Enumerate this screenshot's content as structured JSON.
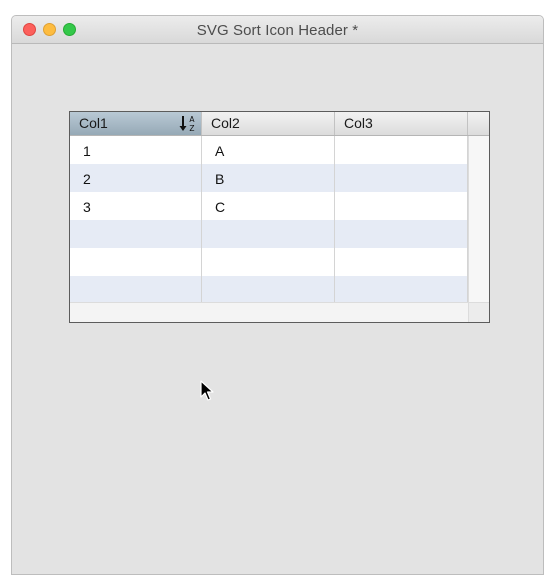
{
  "window": {
    "title": "SVG Sort Icon Header *"
  },
  "table": {
    "columns": [
      {
        "label": "Col1",
        "sorted": true,
        "sort_icon": "sort-a-z-icon"
      },
      {
        "label": "Col2",
        "sorted": false
      },
      {
        "label": "Col3",
        "sorted": false
      }
    ],
    "rows": [
      [
        "1",
        "A",
        ""
      ],
      [
        "2",
        "B",
        ""
      ],
      [
        "3",
        "C",
        ""
      ],
      [
        "",
        "",
        ""
      ],
      [
        "",
        "",
        ""
      ],
      [
        "",
        "",
        ""
      ]
    ]
  },
  "colors": {
    "row_alt": "#e6ebf5",
    "sorted_header": "#a8bac6"
  }
}
